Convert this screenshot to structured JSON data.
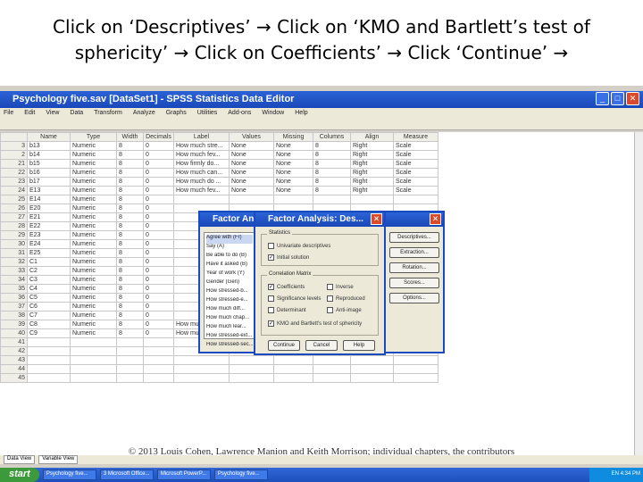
{
  "caption": {
    "line1": "Click on ‘Descriptives’ → Click on ‘KMO and Bartlett’s test of",
    "line2": "sphericity’ → Click on Coefficients’ → Click ‘Continue’ →"
  },
  "window": {
    "title": "Psychology five.sav [DataSet1] - SPSS Statistics Data Editor"
  },
  "menu": [
    "File",
    "Edit",
    "View",
    "Data",
    "Transform",
    "Analyze",
    "Graphs",
    "Utilities",
    "Add-ons",
    "Window",
    "Help"
  ],
  "columns": [
    "Name",
    "Type",
    "Width",
    "Decimals",
    "Label",
    "Values",
    "Missing",
    "Columns",
    "Align",
    "Measure"
  ],
  "rows": [
    {
      "n": "3",
      "name": "b13",
      "type": "Numeric",
      "w": "8",
      "d": "0",
      "label": "How much stre...",
      "values": "None",
      "missing": "None",
      "cols": "8",
      "align": "Right",
      "measure": "Scale"
    },
    {
      "n": "2",
      "name": "b14",
      "type": "Numeric",
      "w": "8",
      "d": "0",
      "label": "How much fev...",
      "values": "None",
      "missing": "None",
      "cols": "8",
      "align": "Right",
      "measure": "Scale"
    },
    {
      "n": "21",
      "name": "b15",
      "type": "Numeric",
      "w": "8",
      "d": "0",
      "label": "How firmly do...",
      "values": "None",
      "missing": "None",
      "cols": "8",
      "align": "Right",
      "measure": "Scale"
    },
    {
      "n": "22",
      "name": "b16",
      "type": "Numeric",
      "w": "8",
      "d": "0",
      "label": "How much can...",
      "values": "None",
      "missing": "None",
      "cols": "8",
      "align": "Right",
      "measure": "Scale"
    },
    {
      "n": "23",
      "name": "b17",
      "type": "Numeric",
      "w": "8",
      "d": "0",
      "label": "How much do ...",
      "values": "None",
      "missing": "None",
      "cols": "8",
      "align": "Right",
      "measure": "Scale"
    },
    {
      "n": "24",
      "name": "E13",
      "type": "Numeric",
      "w": "8",
      "d": "0",
      "label": "How much fev...",
      "values": "None",
      "missing": "None",
      "cols": "8",
      "align": "Right",
      "measure": "Scale"
    },
    {
      "n": "25",
      "name": "E14",
      "type": "Numeric",
      "w": "8",
      "d": "0",
      "label": "",
      "values": "",
      "missing": "",
      "cols": "",
      "align": "",
      "measure": ""
    },
    {
      "n": "26",
      "name": "E20",
      "type": "Numeric",
      "w": "8",
      "d": "0",
      "label": "",
      "values": "",
      "missing": "",
      "cols": "",
      "align": "",
      "measure": ""
    },
    {
      "n": "27",
      "name": "E21",
      "type": "Numeric",
      "w": "8",
      "d": "0",
      "label": "",
      "values": "",
      "missing": "",
      "cols": "",
      "align": "",
      "measure": ""
    },
    {
      "n": "28",
      "name": "E22",
      "type": "Numeric",
      "w": "8",
      "d": "0",
      "label": "",
      "values": "",
      "missing": "",
      "cols": "",
      "align": "",
      "measure": ""
    },
    {
      "n": "29",
      "name": "E23",
      "type": "Numeric",
      "w": "8",
      "d": "0",
      "label": "",
      "values": "",
      "missing": "",
      "cols": "",
      "align": "",
      "measure": ""
    },
    {
      "n": "30",
      "name": "E24",
      "type": "Numeric",
      "w": "8",
      "d": "0",
      "label": "",
      "values": "",
      "missing": "",
      "cols": "",
      "align": "",
      "measure": ""
    },
    {
      "n": "31",
      "name": "E25",
      "type": "Numeric",
      "w": "8",
      "d": "0",
      "label": "",
      "values": "",
      "missing": "",
      "cols": "",
      "align": "",
      "measure": ""
    },
    {
      "n": "32",
      "name": "C1",
      "type": "Numeric",
      "w": "8",
      "d": "0",
      "label": "",
      "values": "",
      "missing": "",
      "cols": "",
      "align": "",
      "measure": ""
    },
    {
      "n": "33",
      "name": "C2",
      "type": "Numeric",
      "w": "8",
      "d": "0",
      "label": "",
      "values": "",
      "missing": "",
      "cols": "",
      "align": "",
      "measure": ""
    },
    {
      "n": "34",
      "name": "C3",
      "type": "Numeric",
      "w": "8",
      "d": "0",
      "label": "",
      "values": "",
      "missing": "",
      "cols": "",
      "align": "",
      "measure": ""
    },
    {
      "n": "35",
      "name": "C4",
      "type": "Numeric",
      "w": "8",
      "d": "0",
      "label": "",
      "values": "",
      "missing": "",
      "cols": "",
      "align": "",
      "measure": ""
    },
    {
      "n": "36",
      "name": "C5",
      "type": "Numeric",
      "w": "8",
      "d": "0",
      "label": "",
      "values": "",
      "missing": "",
      "cols": "",
      "align": "",
      "measure": ""
    },
    {
      "n": "37",
      "name": "C6",
      "type": "Numeric",
      "w": "8",
      "d": "0",
      "label": "",
      "values": "",
      "missing": "",
      "cols": "",
      "align": "",
      "measure": ""
    },
    {
      "n": "38",
      "name": "C7",
      "type": "Numeric",
      "w": "8",
      "d": "0",
      "label": "",
      "values": "",
      "missing": "",
      "cols": "",
      "align": "",
      "measure": ""
    },
    {
      "n": "39",
      "name": "C8",
      "type": "Numeric",
      "w": "8",
      "d": "0",
      "label": "How much frust...",
      "values": "None",
      "missing": "None",
      "cols": "8",
      "align": "Right",
      "measure": "Scale"
    },
    {
      "n": "40",
      "name": "C9",
      "type": "Numeric",
      "w": "8",
      "d": "0",
      "label": "How much frust...",
      "values": "None",
      "missing": "None",
      "cols": "8",
      "align": "Right",
      "measure": "Scale"
    },
    {
      "n": "41",
      "name": "",
      "type": "",
      "w": "",
      "d": "",
      "label": "",
      "values": "",
      "missing": "",
      "cols": "",
      "align": "",
      "measure": ""
    },
    {
      "n": "42",
      "name": "",
      "type": "",
      "w": "",
      "d": "",
      "label": "",
      "values": "",
      "missing": "",
      "cols": "",
      "align": "",
      "measure": ""
    },
    {
      "n": "43",
      "name": "",
      "type": "",
      "w": "",
      "d": "",
      "label": "",
      "values": "",
      "missing": "",
      "cols": "",
      "align": "",
      "measure": ""
    },
    {
      "n": "44",
      "name": "",
      "type": "",
      "w": "",
      "d": "",
      "label": "",
      "values": "",
      "missing": "",
      "cols": "",
      "align": "",
      "measure": ""
    },
    {
      "n": "45",
      "name": "",
      "type": "",
      "w": "",
      "d": "",
      "label": "",
      "values": "",
      "missing": "",
      "cols": "",
      "align": "",
      "measure": ""
    }
  ],
  "dialog_main": {
    "title": "Factor Analysis",
    "variables": [
      "Agree with (Fr)",
      "Say (A)",
      "Be able to do (B)",
      "Have it asked (B)",
      "Year of work (Y)",
      "Gender (Gen)",
      "How stressed-b...",
      "How stressed-e...",
      "How much diff...",
      "How much chap...",
      "How much lear...",
      "How stressed-ext...",
      "How stressed-sec..."
    ],
    "buttons": [
      "Descriptives...",
      "Extraction...",
      "Rotation...",
      "Scores...",
      "Options..."
    ]
  },
  "dialog_desc": {
    "title": "Factor Analysis: Des...",
    "statistics_label": "Statistics",
    "univariate": "Univariate descriptives",
    "initial": "Initial solution",
    "matrix_label": "Correlation Matrix",
    "coefficients": "Coefficients",
    "inverse": "Inverse",
    "significance": "Significance levels",
    "reproduced": "Reproduced",
    "determinant": "Determinant",
    "antiimage": "Anti-image",
    "kmo": "KMO and Bartlett's test of sphericity",
    "continue": "Continue",
    "cancel": "Cancel",
    "help": "Help"
  },
  "view_tabs": [
    "Data View",
    "Variable View"
  ],
  "taskbar": {
    "start": "start",
    "tasks": [
      "Psychology five...",
      "3 Microsoft Office...",
      "Microsoft PowerP...",
      "Psychology five..."
    ],
    "clock": "EN 4:34 PM"
  },
  "copyright": "© 2013 Louis Cohen, Lawrence Manion and Keith Morrison; individual chapters, the contributors"
}
